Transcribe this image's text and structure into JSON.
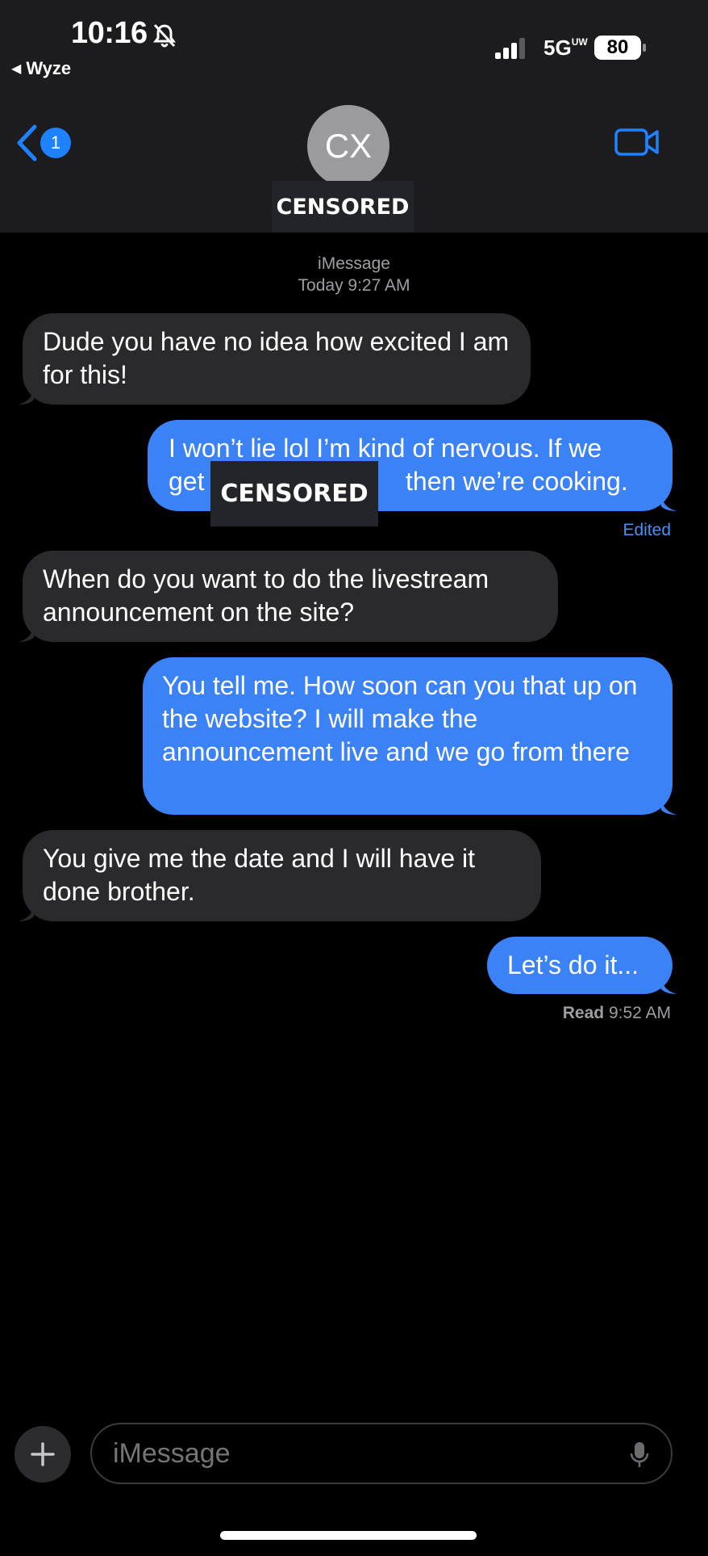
{
  "status_bar": {
    "time": "10:16",
    "back_app": "Wyze",
    "network": "5G",
    "network_sup": "UW",
    "battery": "80"
  },
  "header": {
    "unread_count": "1",
    "avatar_initials": "CX",
    "contact_name": "CENSORED"
  },
  "thread": {
    "service": "iMessage",
    "timestamp": "Today 9:27 AM"
  },
  "messages": [
    {
      "from": "received",
      "text": "Dude you have no idea how excited I am for this!"
    },
    {
      "from": "sent",
      "line1": "I won’t lie lol I’m kind of nervous. If we",
      "line2_start": "get",
      "censored": "CENSORED",
      "line2_end": "then we’re cooking.",
      "status": "Edited"
    },
    {
      "from": "received",
      "text": "When do you want to do the livestream announcement on the site?"
    },
    {
      "from": "sent",
      "text": "You tell me. How soon can you that up on the website? I will make the announcement live and we go from there"
    },
    {
      "from": "received",
      "text": "You give me the date and I will have it done brother."
    },
    {
      "from": "sent",
      "text": "Let’s do it..."
    }
  ],
  "read_receipt": {
    "label": "Read",
    "time": "9:52 AM"
  },
  "composer": {
    "placeholder": "iMessage"
  },
  "colors": {
    "sent_bubble": "#3b82f6",
    "received_bubble": "#2a2a2d",
    "accent": "#1e82ff"
  }
}
